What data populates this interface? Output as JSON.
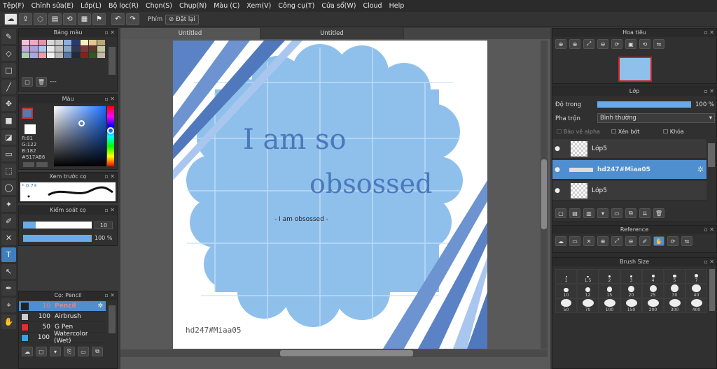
{
  "menu": [
    "Tệp(F)",
    "Chỉnh sửa(E)",
    "Lớp(L)",
    "Bộ lọc(R)",
    "Chọn(S)",
    "Chụp(N)",
    "Màu (C)",
    "Xem(V)",
    "Công cụ(T)",
    "Cửa sổ(W)",
    "Cloud",
    "Help"
  ],
  "toolbar": {
    "phim_label": "Phím",
    "reset_label": "Đặt lại"
  },
  "tabs": [
    "Untitled",
    "Untitled"
  ],
  "palette": {
    "title": "Bảng màu",
    "footer_text": "---",
    "colors": [
      "#f8c0d8",
      "#f0a8c8",
      "#e890b0",
      "#d8d8d8",
      "#c8c8c8",
      "#8ab0e0",
      "#2a3a6a",
      "#f8f0c0",
      "#e0c890",
      "#b8a878",
      "#c8a8e0",
      "#b0a0d8",
      "#a8c8f0",
      "#e8e8e8",
      "#c0c0c0",
      "#88a8c8",
      "#2f3a50",
      "#7a3a3a",
      "#5a3a2a",
      "#c8c8a0",
      "#a8d0b8",
      "#a8a8e0",
      "#e8a0a8",
      "#f0f0f0",
      "#b8b8b8",
      "#5878a8",
      "#1f2a3a",
      "#882020",
      "#2a5a2a",
      "#c8b8a8"
    ]
  },
  "color": {
    "title": "Màu",
    "r": "R:81",
    "g": "G:122",
    "b": "B:182",
    "hex": "#517AB6",
    "current": "#517AB6"
  },
  "brush_preview": {
    "title": "Xem trước cọ",
    "size_text": "* 0.73"
  },
  "brush_control": {
    "title": "Kiểm soát cọ",
    "size": "10",
    "opacity": "100 %"
  },
  "brushes": {
    "title": "Cọ: Pencil",
    "items": [
      {
        "size": "10",
        "name": "Pencil",
        "color": "#222222",
        "selected": true
      },
      {
        "size": "100",
        "name": "Airbrush",
        "color": "#cccccc",
        "selected": false
      },
      {
        "size": "50",
        "name": "G Pen",
        "color": "#e03030",
        "selected": false
      },
      {
        "size": "100",
        "name": "Watercolor (Wet)",
        "color": "#3fa0e0",
        "selected": false
      }
    ]
  },
  "navigator": {
    "title": "Hoa tiêu"
  },
  "layers": {
    "title": "Lớp",
    "opacity_label": "Độ trong",
    "opacity_value": "100 %",
    "blend_label": "Pha trộn",
    "blend_value": "Bình thường",
    "protect_alpha": "Bảo vệ alpha",
    "clipping": "Xén bớt",
    "lock": "Khóa",
    "items": [
      {
        "name": "Lớp5",
        "selected": false
      },
      {
        "name": "hd247#Miaa05",
        "selected": true
      },
      {
        "name": "Lớp5",
        "selected": false
      }
    ]
  },
  "reference": {
    "title": "Reference"
  },
  "brush_size": {
    "title": "Brush Size",
    "sizes": [
      "1",
      "1.5",
      "2",
      "3",
      "4",
      "5",
      "7",
      "10",
      "12",
      "15",
      "20",
      "25",
      "30",
      "40",
      "50",
      "70",
      "100",
      "150",
      "200",
      "300",
      "400"
    ]
  },
  "artwork": {
    "line1": "I am so",
    "line2": "obsossed",
    "subtitle": "- I am obsossed -",
    "signature": "hd247#Miaa05"
  }
}
